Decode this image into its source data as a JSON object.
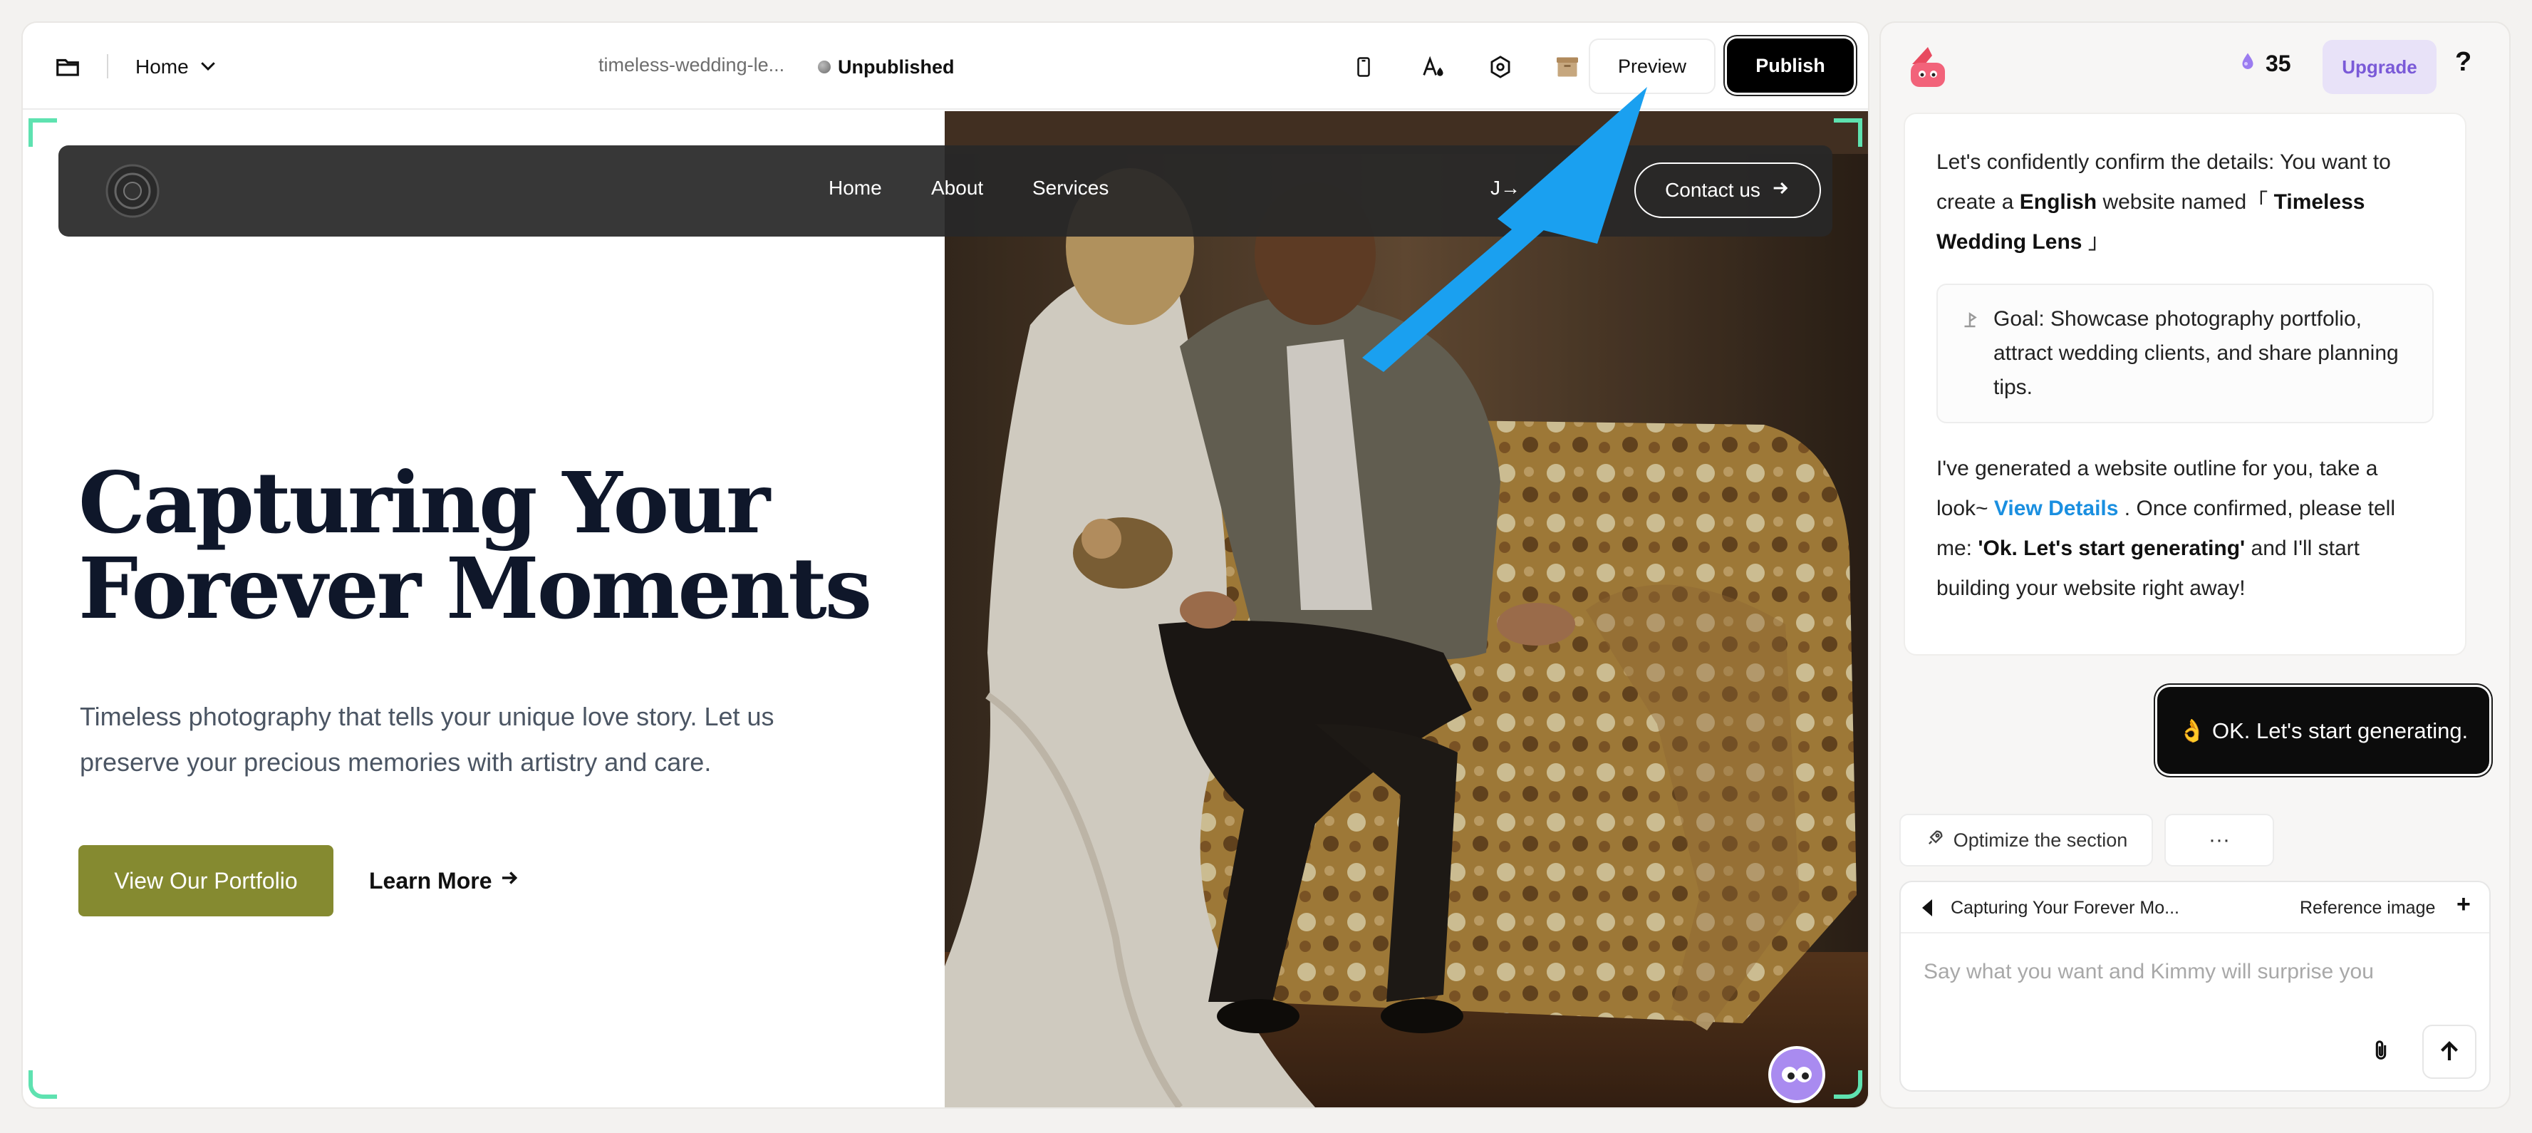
{
  "topbar": {
    "page_label": "Home",
    "slug": "timeless-wedding-le...",
    "status": "Unpublished",
    "preview_label": "Preview",
    "publish_label": "Publish",
    "icons": [
      "folder-icon",
      "chevron-down-icon",
      "mobile-device-icon",
      "text-color-icon",
      "settings-gear-icon",
      "package-box-icon"
    ]
  },
  "site": {
    "nav": {
      "links": [
        "Home",
        "About",
        "Services"
      ],
      "extra_text": "J→",
      "contact_label": "Contact us"
    },
    "hero": {
      "title_line1": "Capturing Your",
      "title_line2": "Forever Moments",
      "subtitle_line1": "Timeless photography that tells your unique love story. Let us",
      "subtitle_line2": "preserve your precious memories with artistry and care.",
      "primary_cta": "View Our Portfolio",
      "secondary_cta": "Learn More"
    }
  },
  "chat": {
    "credits": "35",
    "upgrade_label": "Upgrade",
    "help_label": "?",
    "assistant": {
      "confirm_prefix": "Let's confidently confirm the details: You want to create a",
      "language": "English",
      "website_named": "website named「",
      "site_name": "Timeless Wedding Lens",
      "close_bracket": "」",
      "goal": "Goal: Showcase photography portfolio, attract wedding clients, and share planning tips.",
      "outline_prefix": "I've generated a website outline for you, take a look~",
      "view_details": "View Details",
      "outline_mid": ". Once confirmed, please tell me:",
      "command": "'Ok. Let's start generating'",
      "outline_suffix": "and I'll start building your website right away!"
    },
    "user_message": "👌 OK. Let's start generating.",
    "optimize_label": "Optimize the section",
    "more_label": "···",
    "composer": {
      "context_label": "Capturing Your Forever Mo...",
      "reference_label": "Reference image",
      "plus_label": "+",
      "placeholder": "Say what you want and Kimmy will surprise you",
      "value": ""
    }
  },
  "colors": {
    "accent_green_cta": "#858a30",
    "link_blue": "#1a8fe0",
    "upgrade_bg": "#e8e2f8",
    "upgrade_text": "#7a5ad8",
    "guide_corner": "#5ee2b0",
    "pointer_arrow": "#1aa0f0"
  }
}
